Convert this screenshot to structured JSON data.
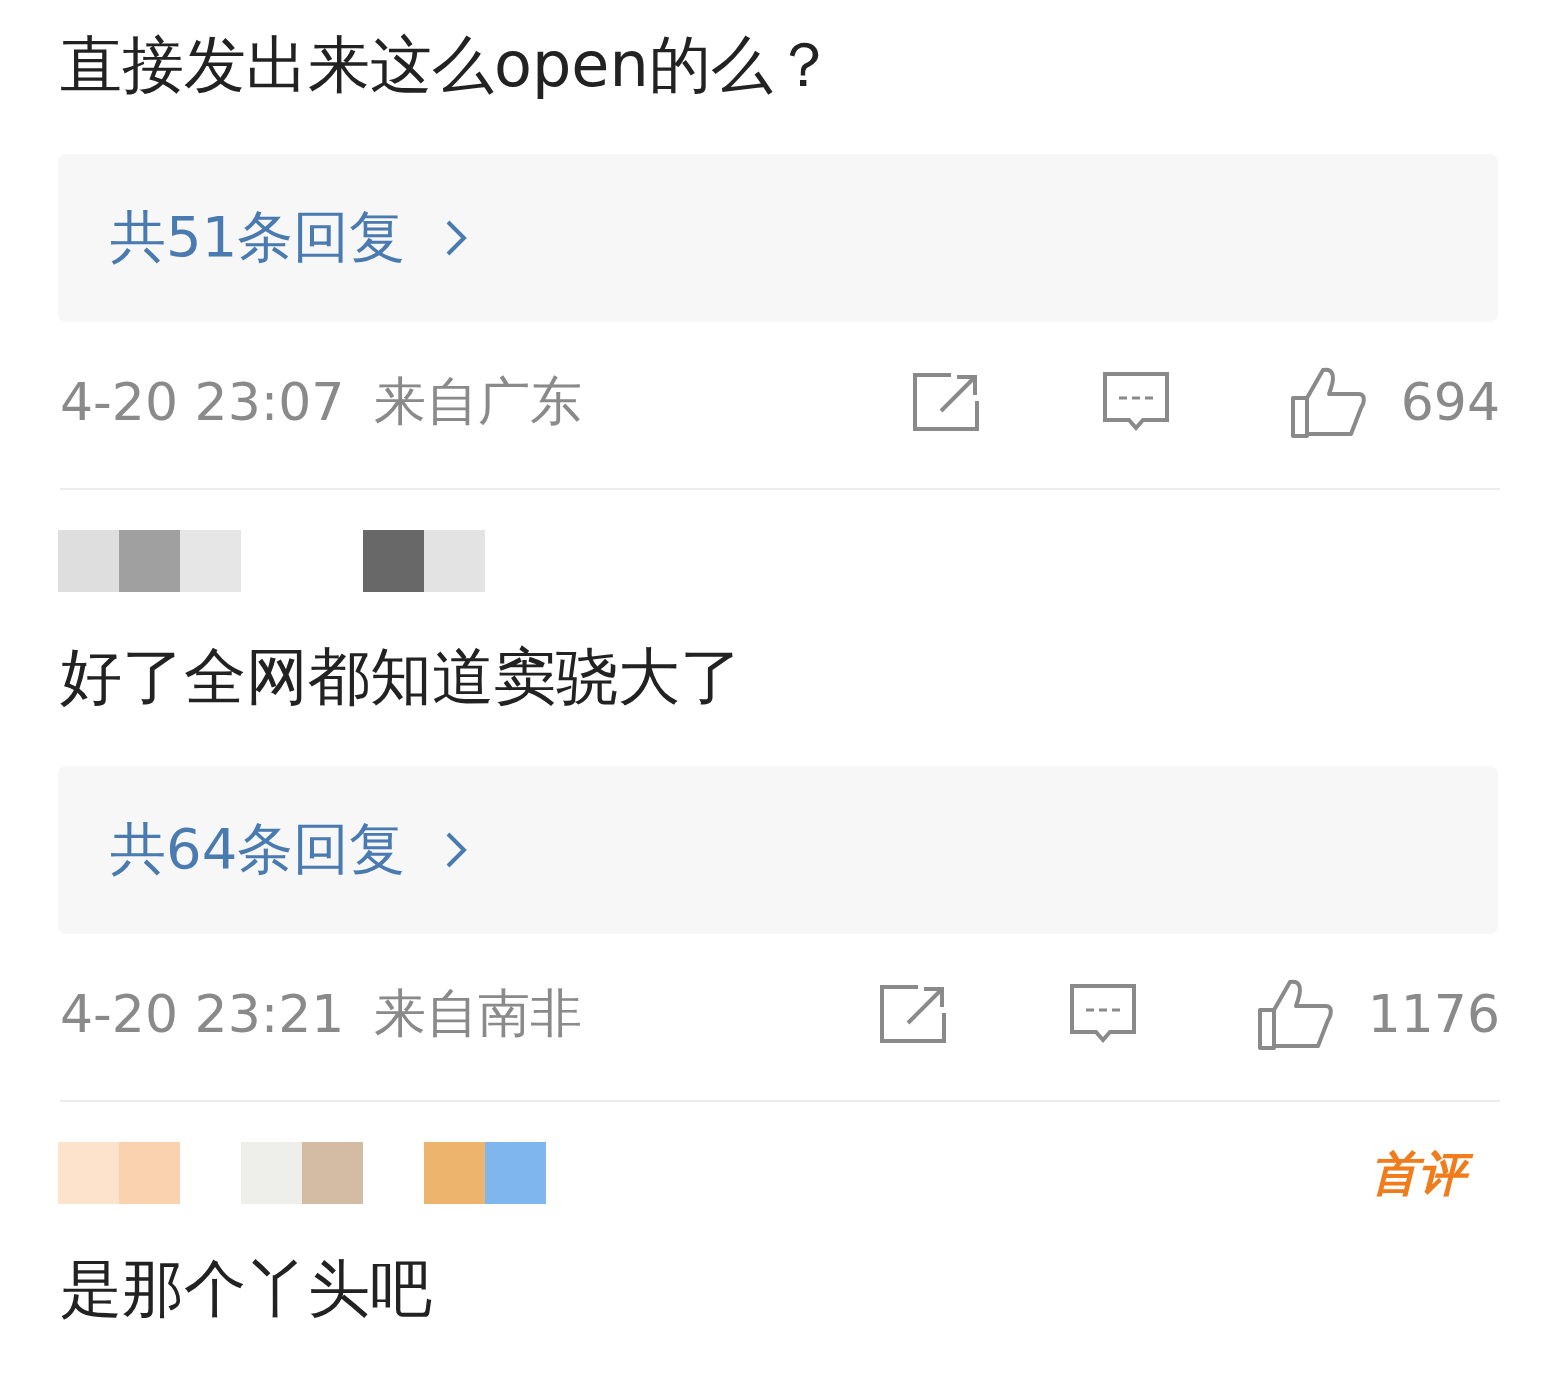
{
  "comments": [
    {
      "author_masked": false,
      "text": "直接发出来这么open的么？",
      "replies": "共51条回复",
      "time": "4-20 23:07",
      "location": "来自广东",
      "likes": "694"
    },
    {
      "author_masked": true,
      "text": "好了全网都知道窦骁大了",
      "replies": "共64条回复",
      "time": "4-20 23:21",
      "location": "来自南非",
      "likes": "1176"
    },
    {
      "author_masked": true,
      "badge": "首评",
      "text": "是那个丫头吧"
    }
  ]
}
